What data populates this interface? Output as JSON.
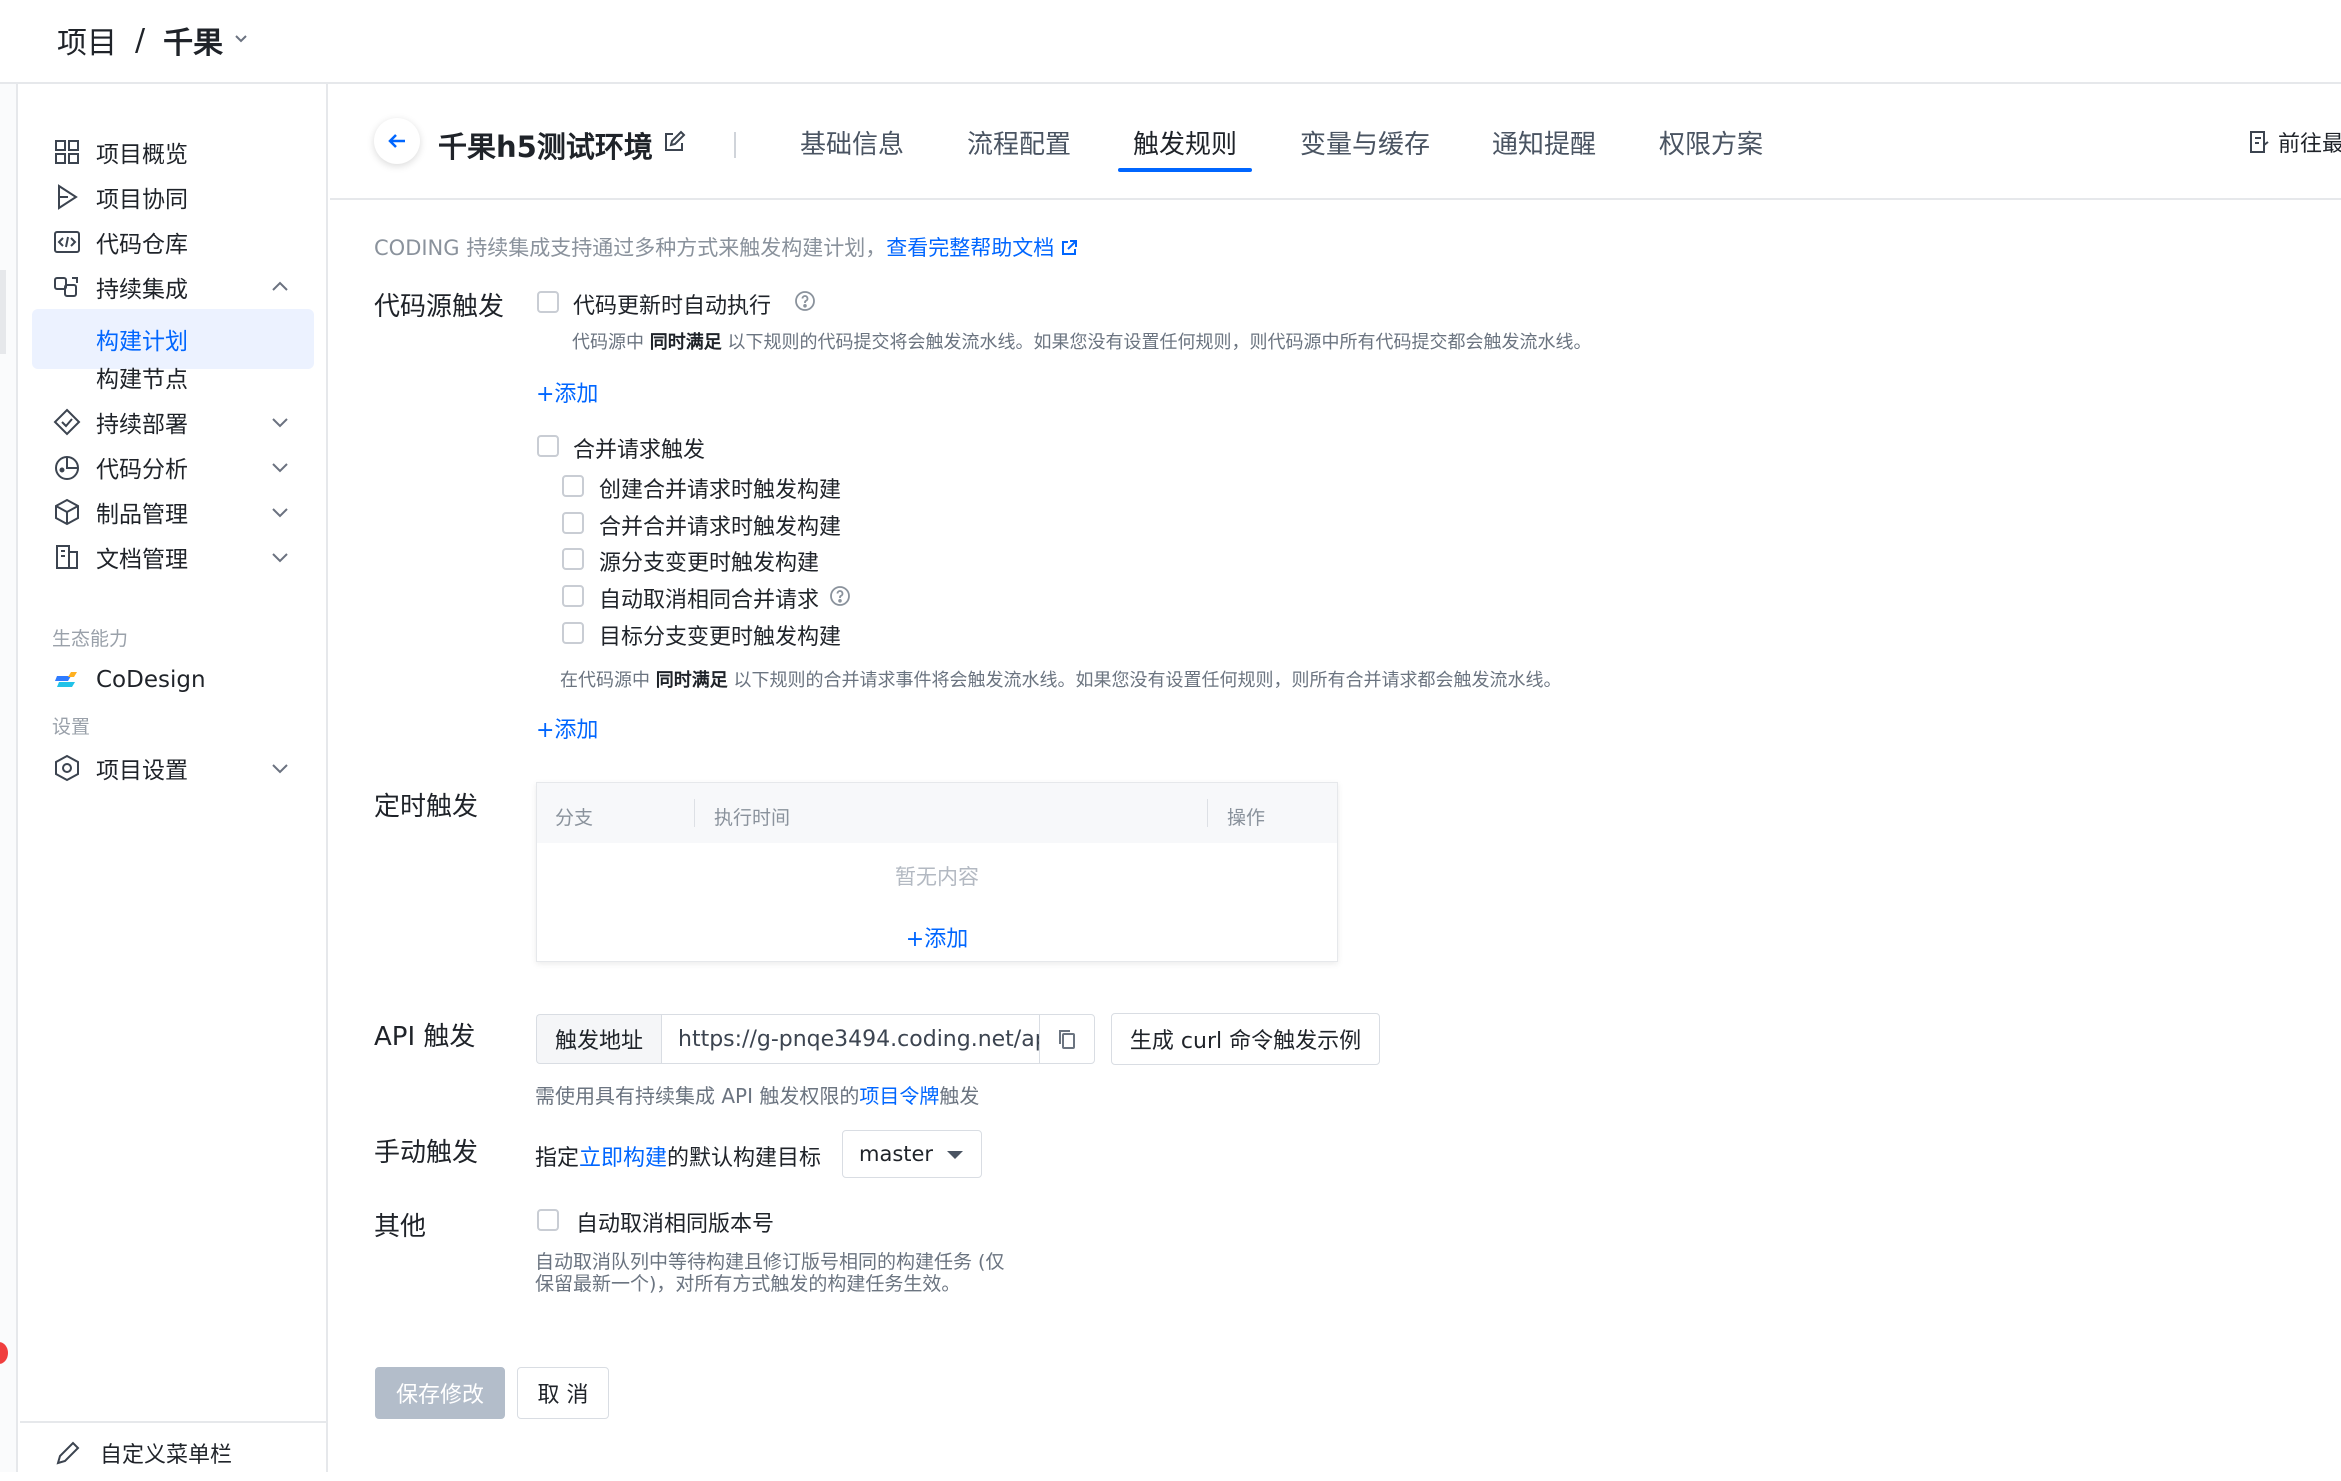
{
  "breadcrumb": {
    "root": "项目",
    "separator": "/",
    "project": "千果"
  },
  "sidebar": {
    "items": [
      {
        "label": "项目概览",
        "icon": "grid-icon"
      },
      {
        "label": "项目协同",
        "icon": "play-icon"
      },
      {
        "label": "代码仓库",
        "icon": "code-icon"
      },
      {
        "label": "持续集成",
        "icon": "ci-icon",
        "expanded": true
      },
      {
        "label": "构建计划",
        "active": true
      },
      {
        "label": "构建节点"
      },
      {
        "label": "持续部署",
        "icon": "deploy-icon"
      },
      {
        "label": "代码分析",
        "icon": "analysis-icon"
      },
      {
        "label": "制品管理",
        "icon": "package-icon"
      },
      {
        "label": "文档管理",
        "icon": "document-icon"
      }
    ],
    "section_ecosystem": "生态能力",
    "codesign": "CoDesign",
    "section_settings": "设置",
    "project_settings": "项目设置",
    "footer": "自定义菜单栏"
  },
  "topbar": {
    "title": "千果h5测试环境",
    "tabs": [
      "基础信息",
      "流程配置",
      "触发规则",
      "变量与缓存",
      "通知提醒",
      "权限方案"
    ],
    "active_tab": "触发规则",
    "goto": "前往最"
  },
  "intro": {
    "text": "CODING 持续集成支持通过多种方式来触发构建计划，",
    "link": "查看完整帮助文档"
  },
  "code_source": {
    "label": "代码源触发",
    "auto_run": "代码更新时自动执行",
    "hint_pre": "代码源中 ",
    "hint_bold": "同时满足",
    "hint_post": " 以下规则的代码提交将会触发流水线。如果您没有设置任何规则，则代码源中所有代码提交都会触发流水线。",
    "add": "+添加",
    "merge_request": "合并请求触发",
    "mr_options": [
      "创建合并请求时触发构建",
      "合并合并请求时触发构建",
      "源分支变更时触发构建",
      "自动取消相同合并请求",
      "目标分支变更时触发构建"
    ],
    "mr_hint_pre": "在代码源中 ",
    "mr_hint_bold": "同时满足",
    "mr_hint_post": " 以下规则的合并请求事件将会触发流水线。如果您没有设置任何规则，则所有合并请求都会触发流水线。",
    "mr_add": "+添加"
  },
  "schedule": {
    "label": "定时触发",
    "columns": [
      "分支",
      "执行时间",
      "操作"
    ],
    "empty": "暂无内容",
    "add": "+添加"
  },
  "api": {
    "label": "API 触发",
    "prefix": "触发地址",
    "url": "https://g-pnqe3494.coding.net/ap",
    "curl_button": "生成 curl 命令触发示例",
    "hint_pre": "需使用具有持续集成 API 触发权限的",
    "hint_link": "项目令牌",
    "hint_post": "触发"
  },
  "manual": {
    "label": "手动触发",
    "pre": "指定",
    "link": "立即构建",
    "post": "的默认构建目标",
    "selected": "master"
  },
  "other": {
    "label": "其他",
    "option": "自动取消相同版本号",
    "hint_line1": "自动取消队列中等待构建且修订版号相同的构建任务 (仅",
    "hint_line2": "保留最新一个)，对所有方式触发的构建任务生效。"
  },
  "actions": {
    "save": "保存修改",
    "cancel": "取 消"
  },
  "colors": {
    "accent": "#0066ff",
    "active_bg": "#ecf2ff",
    "disabled_button": "#b3bdca"
  }
}
